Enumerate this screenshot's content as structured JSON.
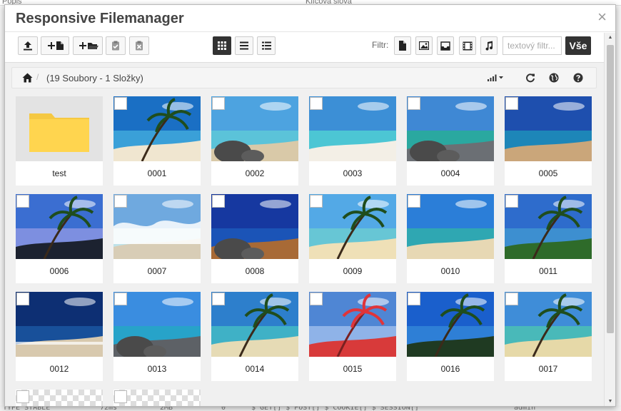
{
  "background": {
    "top_labels": [
      "Popis",
      "Klíčová slova"
    ],
    "bottom_labels": [
      "TYPE STABLE",
      "72ms",
      "2MB",
      "0",
      "$_GET[] $_POST[] $_COOKIE[] $_SESSION[]",
      "admin"
    ]
  },
  "modal": {
    "title": "Responsive Filemanager",
    "close": "×"
  },
  "toolbar": {
    "buttons": [
      {
        "name": "upload-button",
        "icon": "upload-icon"
      },
      {
        "name": "new-file-button",
        "icon": "plus-file-icon"
      },
      {
        "name": "new-folder-button",
        "icon": "plus-folder-icon"
      },
      {
        "name": "paste-button",
        "icon": "clipboard-check-icon"
      },
      {
        "name": "clear-clipboard-button",
        "icon": "clipboard-x-icon"
      }
    ],
    "views": [
      {
        "name": "grid-view-button",
        "icon": "grid-icon",
        "active": true
      },
      {
        "name": "list-view-button",
        "icon": "list-icon",
        "active": false
      },
      {
        "name": "columns-view-button",
        "icon": "columns-icon",
        "active": false
      }
    ],
    "filter_label": "Filtr:",
    "filter_types": [
      "file-icon",
      "image-icon",
      "archive-icon",
      "video-icon",
      "music-icon"
    ],
    "filter_placeholder": "textový filtr...",
    "all_label": "Vše"
  },
  "breadcrumb": {
    "separator": "/",
    "summary": "(19 Soubory - 1 Složky)"
  },
  "items": [
    {
      "label": "test",
      "type": "folder"
    },
    {
      "label": "0001",
      "type": "image",
      "scene": "palm-beach",
      "sky": "#1a6fc4",
      "sea": "#3aa0d8",
      "sand": "#f0e6d0"
    },
    {
      "label": "0002",
      "type": "image",
      "scene": "rocks",
      "sky": "#4da3e0",
      "sea": "#5bc3d9",
      "sand": "#d9c9a8"
    },
    {
      "label": "0003",
      "type": "image",
      "scene": "beach",
      "sky": "#3c8fd6",
      "sea": "#4cc6d4",
      "sand": "#f3efe6"
    },
    {
      "label": "0004",
      "type": "image",
      "scene": "rocks",
      "sky": "#3f88d4",
      "sea": "#2aa8a0",
      "sand": "#6b6f74"
    },
    {
      "label": "0005",
      "type": "image",
      "scene": "beach",
      "sky": "#1e4fae",
      "sea": "#1d86b8",
      "sand": "#caa67a"
    },
    {
      "label": "0006",
      "type": "image",
      "scene": "palm-sunset",
      "sky": "#3b6ed1",
      "sea": "#7d8fe0",
      "sand": "#1c2230"
    },
    {
      "label": "0007",
      "type": "image",
      "scene": "wave",
      "sky": "#6fa9df",
      "sea": "#bfe3ea",
      "sand": "#d8cdb6"
    },
    {
      "label": "0008",
      "type": "image",
      "scene": "rocks",
      "sky": "#1638a0",
      "sea": "#1b54b7",
      "sand": "#a86a36"
    },
    {
      "label": "0009",
      "type": "image",
      "scene": "palm-beach",
      "sky": "#53a9e6",
      "sea": "#67c6d5",
      "sand": "#efe0b7"
    },
    {
      "label": "0010",
      "type": "image",
      "scene": "beach",
      "sky": "#2b7ed8",
      "sea": "#2fa7b2",
      "sand": "#e7d8b4"
    },
    {
      "label": "0011",
      "type": "image",
      "scene": "palm-beach",
      "sky": "#2e6ccc",
      "sea": "#3d8fd0",
      "sand": "#2e6b2a"
    },
    {
      "label": "0012",
      "type": "image",
      "scene": "sea",
      "sky": "#0d2f73",
      "sea": "#18509a",
      "sand": "#d8c9ae"
    },
    {
      "label": "0013",
      "type": "image",
      "scene": "rocks",
      "sky": "#3a8de0",
      "sea": "#27a3c9",
      "sand": "#5d6166"
    },
    {
      "label": "0014",
      "type": "image",
      "scene": "palm-beach",
      "sky": "#2d7fcc",
      "sea": "#3fb1c6",
      "sand": "#e6dbb5"
    },
    {
      "label": "0015",
      "type": "image",
      "scene": "red-palm",
      "sky": "#4f86d4",
      "sea": "#8fb3e8",
      "sand": "#d83a3a"
    },
    {
      "label": "0016",
      "type": "image",
      "scene": "palm-beach",
      "sky": "#1a5fcc",
      "sea": "#2e7fd6",
      "sand": "#1f3a22"
    },
    {
      "label": "0017",
      "type": "image",
      "scene": "palm-beach",
      "sky": "#3f8dd8",
      "sea": "#49b9b9",
      "sand": "#e6d9a8"
    },
    {
      "label": "",
      "type": "checker"
    },
    {
      "label": "",
      "type": "checker"
    }
  ]
}
